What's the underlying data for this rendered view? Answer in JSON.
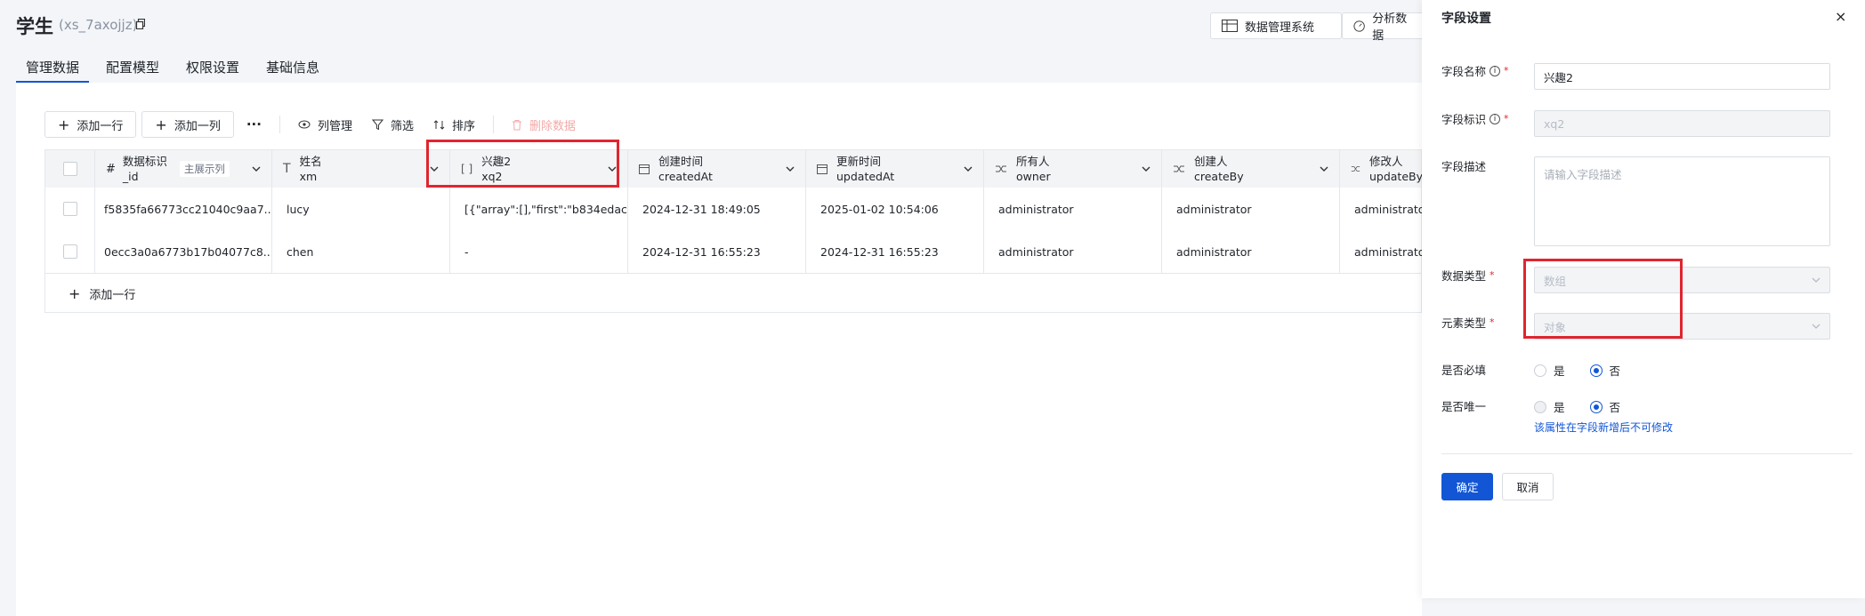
{
  "header": {
    "title": "学生",
    "subtitle": "(xs_7axojjz)",
    "btn_system": "数据管理系统",
    "btn_analysis": "分析数据"
  },
  "tabs": [
    "管理数据",
    "配置模型",
    "权限设置",
    "基础信息"
  ],
  "toolbar": {
    "add_row": "添加一行",
    "add_col": "添加一列",
    "more": "···",
    "col_manage": "列管理",
    "filter": "筛选",
    "sort": "排序",
    "delete": "删除数据"
  },
  "table": {
    "columns": [
      {
        "name": "数据标识",
        "key": "_id",
        "badge": "主展示列",
        "icon": "#"
      },
      {
        "name": "姓名",
        "key": "xm",
        "icon": "T"
      },
      {
        "name": "兴趣2",
        "key": "xq2",
        "icon": "[]"
      },
      {
        "name": "创建时间",
        "key": "createdAt",
        "icon": "date"
      },
      {
        "name": "更新时间",
        "key": "updatedAt",
        "icon": "date"
      },
      {
        "name": "所有人",
        "key": "owner",
        "icon": "relation"
      },
      {
        "name": "创建人",
        "key": "createBy",
        "icon": "relation"
      },
      {
        "name": "修改人",
        "key": "updateBy",
        "icon": "relation"
      }
    ],
    "rows": [
      [
        "f5835fa66773cc21040c9aa7...",
        "lucy",
        "[{\"array\":[],\"first\":\"b834edac...",
        "2024-12-31 18:49:05",
        "2025-01-02 10:54:06",
        "administrator",
        "administrator",
        "administrator"
      ],
      [
        "0ecc3a0a6773b17b04077c8...",
        "chen",
        "-",
        "2024-12-31 16:55:23",
        "2024-12-31 16:55:23",
        "administrator",
        "administrator",
        "administrator"
      ]
    ],
    "add_row": "添加一行"
  },
  "drawer": {
    "title": "字段设置",
    "close": "×",
    "field_name_label": "字段名称",
    "field_name_value": "兴趣2",
    "field_key_label": "字段标识",
    "field_key_value": "xq2",
    "desc_label": "字段描述",
    "desc_placeholder": "请输入字段描述",
    "data_type_label": "数据类型",
    "data_type_value": "数组",
    "elem_type_label": "元素类型",
    "elem_type_value": "对象",
    "required_label": "是否必填",
    "unique_label": "是否唯一",
    "yes": "是",
    "no": "否",
    "unique_hint": "该属性在字段新增后不可修改",
    "confirm": "确定",
    "cancel": "取消"
  },
  "colors": {
    "accent": "#1256d6",
    "highlight": "#e0252f"
  }
}
